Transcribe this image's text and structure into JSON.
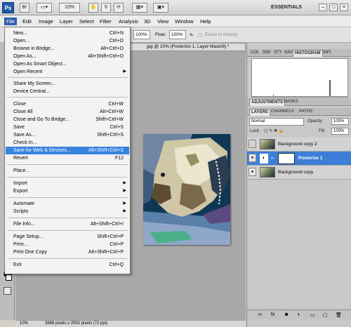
{
  "appbar": {
    "logo": "Ps",
    "br": "Br",
    "zoom": "10%",
    "workspace": "ESSENTIALS",
    "win_min": "–",
    "win_max": "□",
    "win_close": "×"
  },
  "menubar": [
    "File",
    "Edit",
    "Image",
    "Layer",
    "Select",
    "Filter",
    "Analysis",
    "3D",
    "View",
    "Window",
    "Help"
  ],
  "options": {
    "opacity_value": "100%",
    "flow_label": "Flow:",
    "flow_value": "100%",
    "airbrush_label": "Erase to History"
  },
  "document": {
    "tab_title": "jpg @ 10% (Posterize 1, Layer Mask/8) *",
    "status_zoom": "10%",
    "status_info": "3888 pixels x 2592 pixels (72 ppi)"
  },
  "file_menu": [
    {
      "label": "New...",
      "shortcut": "Ctrl+N"
    },
    {
      "label": "Open...",
      "shortcut": "Ctrl+O"
    },
    {
      "label": "Browse in Bridge...",
      "shortcut": "Alt+Ctrl+O"
    },
    {
      "label": "Open As...",
      "shortcut": "Alt+Shift+Ctrl+O"
    },
    {
      "label": "Open As Smart Object...",
      "shortcut": ""
    },
    {
      "label": "Open Recent",
      "shortcut": ""
    },
    {
      "label": "Share My Screen...",
      "shortcut": ""
    },
    {
      "label": "Device Central...",
      "shortcut": ""
    },
    {
      "label": "Close",
      "shortcut": "Ctrl+W"
    },
    {
      "label": "Close All",
      "shortcut": "Alt+Ctrl+W"
    },
    {
      "label": "Close and Go To Bridge...",
      "shortcut": "Shift+Ctrl+W"
    },
    {
      "label": "Save",
      "shortcut": "Ctrl+S"
    },
    {
      "label": "Save As...",
      "shortcut": "Shift+Ctrl+S"
    },
    {
      "label": "Check In...",
      "shortcut": ""
    },
    {
      "label": "Save for Web & Devices...",
      "shortcut": "Alt+Shift+Ctrl+S"
    },
    {
      "label": "Revert",
      "shortcut": "F12"
    },
    {
      "label": "Place...",
      "shortcut": ""
    },
    {
      "label": "Import",
      "shortcut": ""
    },
    {
      "label": "Export",
      "shortcut": ""
    },
    {
      "label": "Automate",
      "shortcut": ""
    },
    {
      "label": "Scripts",
      "shortcut": ""
    },
    {
      "label": "File Info...",
      "shortcut": "Alt+Shift+Ctrl+I"
    },
    {
      "label": "Page Setup...",
      "shortcut": "Shift+Ctrl+P"
    },
    {
      "label": "Print...",
      "shortcut": "Ctrl+P"
    },
    {
      "label": "Print One Copy",
      "shortcut": "Alt+Shift+Ctrl+P"
    },
    {
      "label": "Exit",
      "shortcut": "Ctrl+Q"
    }
  ],
  "panels": {
    "top_tabs": [
      "COL",
      "SWI",
      "STY",
      "NAV",
      "HISTOGRAM",
      "INFI"
    ],
    "adj_tabs": [
      "ADJUSTMENTS",
      "MASKS"
    ],
    "layer_tabs": [
      "LAYERS",
      "CHANNELS",
      "PATHS"
    ],
    "blend_mode": "Normal",
    "opacity_label": "Opacity:",
    "opacity_value": "100%",
    "lock_label": "Lock:",
    "fill_label": "Fill:",
    "fill_value": "100%",
    "layers": [
      {
        "name": "Background copy 2",
        "selected": false
      },
      {
        "name": "Posterize 1",
        "selected": true
      },
      {
        "name": "Background copy",
        "selected": false
      }
    ]
  }
}
